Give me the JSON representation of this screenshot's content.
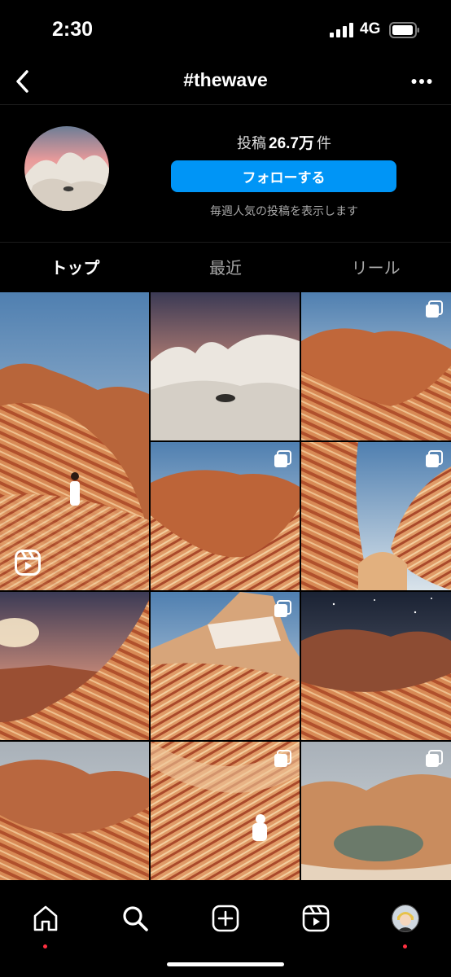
{
  "status_bar": {
    "time": "2:30",
    "network": "4G"
  },
  "header": {
    "title": "#thewave"
  },
  "hashtag_info": {
    "posts_prefix": "投稿",
    "posts_count": "26.7万",
    "posts_suffix": "件",
    "follow_label": "フォローする",
    "note": "毎週人気の投稿を表示します"
  },
  "tabs": [
    {
      "label": "トップ",
      "active": true
    },
    {
      "label": "最近",
      "active": false
    },
    {
      "label": "リール",
      "active": false
    }
  ],
  "icons": {
    "back": "chevron-left-icon",
    "more": "more-horizontal-icon",
    "multi": "multiple-posts-icon",
    "reel": "reels-icon",
    "nav": [
      "home-icon",
      "search-icon",
      "create-icon",
      "reels-icon",
      "profile-avatar"
    ]
  },
  "colors": {
    "accent": "#0095f6",
    "notification": "#ff3040",
    "background": "#000000"
  }
}
